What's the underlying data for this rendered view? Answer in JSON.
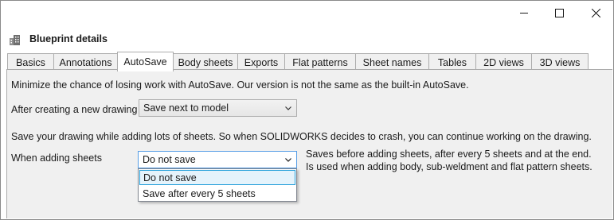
{
  "window": {
    "icons": {
      "minimize": "minimize-icon",
      "maximize": "maximize-icon",
      "close": "close-icon",
      "app": "building-icon"
    }
  },
  "header": {
    "title": "Blueprint details"
  },
  "tabs": [
    {
      "label": "Basics",
      "active": false
    },
    {
      "label": "Annotations",
      "active": false
    },
    {
      "label": "AutoSave",
      "active": true
    },
    {
      "label": "Body sheets",
      "active": false
    },
    {
      "label": "Exports",
      "active": false
    },
    {
      "label": "Flat patterns",
      "active": false
    },
    {
      "label": "Sheet names",
      "active": false
    },
    {
      "label": "Tables",
      "active": false
    },
    {
      "label": "2D views",
      "active": false
    },
    {
      "label": "3D views",
      "active": false
    }
  ],
  "autosave": {
    "intro": "Minimize the chance of losing work with AutoSave. Our version is not the same as the built-in AutoSave.",
    "new_drawing": {
      "label": "After creating a new drawing",
      "value": "Save next to model"
    },
    "sheets_intro": "Save your drawing while adding lots of sheets. So when SOLIDWORKS decides to crash, you can continue working on the drawing.",
    "adding_sheets": {
      "label": "When adding sheets",
      "value": "Do not save",
      "options": [
        "Do not save",
        "Save after every 5 sheets"
      ],
      "highlighted_index": 0,
      "help": "Saves before adding sheets, after every 5 sheets and at the end. Is used when adding body, sub-weldment and flat pattern sheets."
    }
  },
  "colors": {
    "accent": "#569de5",
    "selection_bg": "#e5f3fb",
    "selection_border": "#26a0da",
    "panel_bg": "#f0f0f0"
  }
}
